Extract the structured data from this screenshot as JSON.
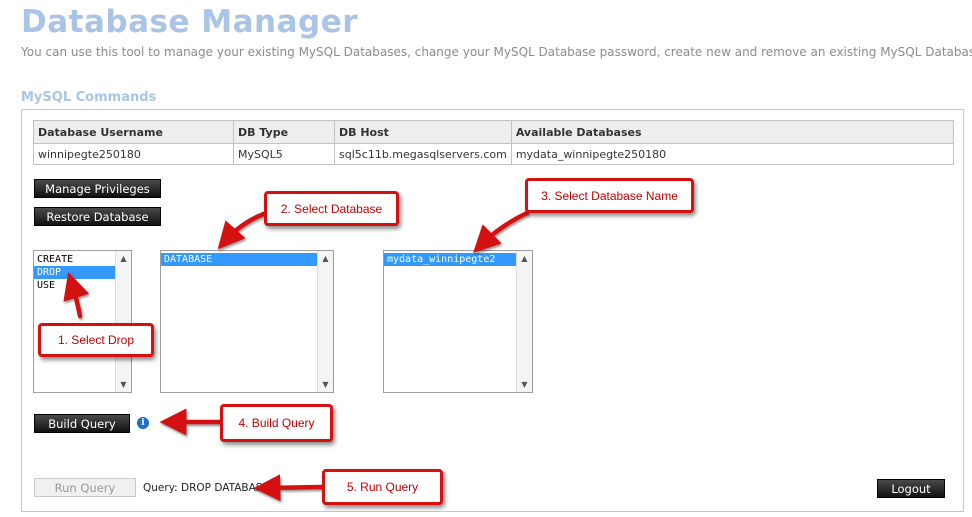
{
  "header": {
    "title": "Database Manager",
    "subtitle": "You can use this tool to manage your existing MySQL Databases, change your MySQL Database password, create new and remove an existing MySQL Database"
  },
  "section": {
    "title": "MySQL Commands"
  },
  "table": {
    "headers": [
      "Database Username",
      "DB Type",
      "DB Host",
      "Available Databases"
    ],
    "row": [
      "winnipegte250180",
      "MySQL5",
      "sql5c11b.megasqlservers.com",
      "mydata_winnipegte250180"
    ]
  },
  "buttons": {
    "manage_privileges": "Manage Privileges",
    "restore_database": "Restore Database",
    "build_query": "Build Query",
    "run_query": "Run Query",
    "logout": "Logout"
  },
  "lists": {
    "commands": [
      "CREATE",
      "DROP",
      "USE"
    ],
    "commands_selected": "DROP",
    "targets": [
      "DATABASE"
    ],
    "databases": [
      "mydata_winnipegte2"
    ]
  },
  "query": {
    "text": "Query: DROP DATABASE"
  },
  "callouts": {
    "step1": "1. Select Drop",
    "step2": "2. Select Database",
    "step3": "3. Select Database Name",
    "step4": "4. Build Query",
    "step5": "5. Run Query"
  },
  "icons": {
    "info": "info-icon",
    "scroll_up": "scroll-up-icon",
    "scroll_down": "scroll-down-icon"
  },
  "colors": {
    "title": "#a9c4e6",
    "selection": "#3399ff",
    "callout_border": "#d41010",
    "callout_text": "#c40000"
  }
}
